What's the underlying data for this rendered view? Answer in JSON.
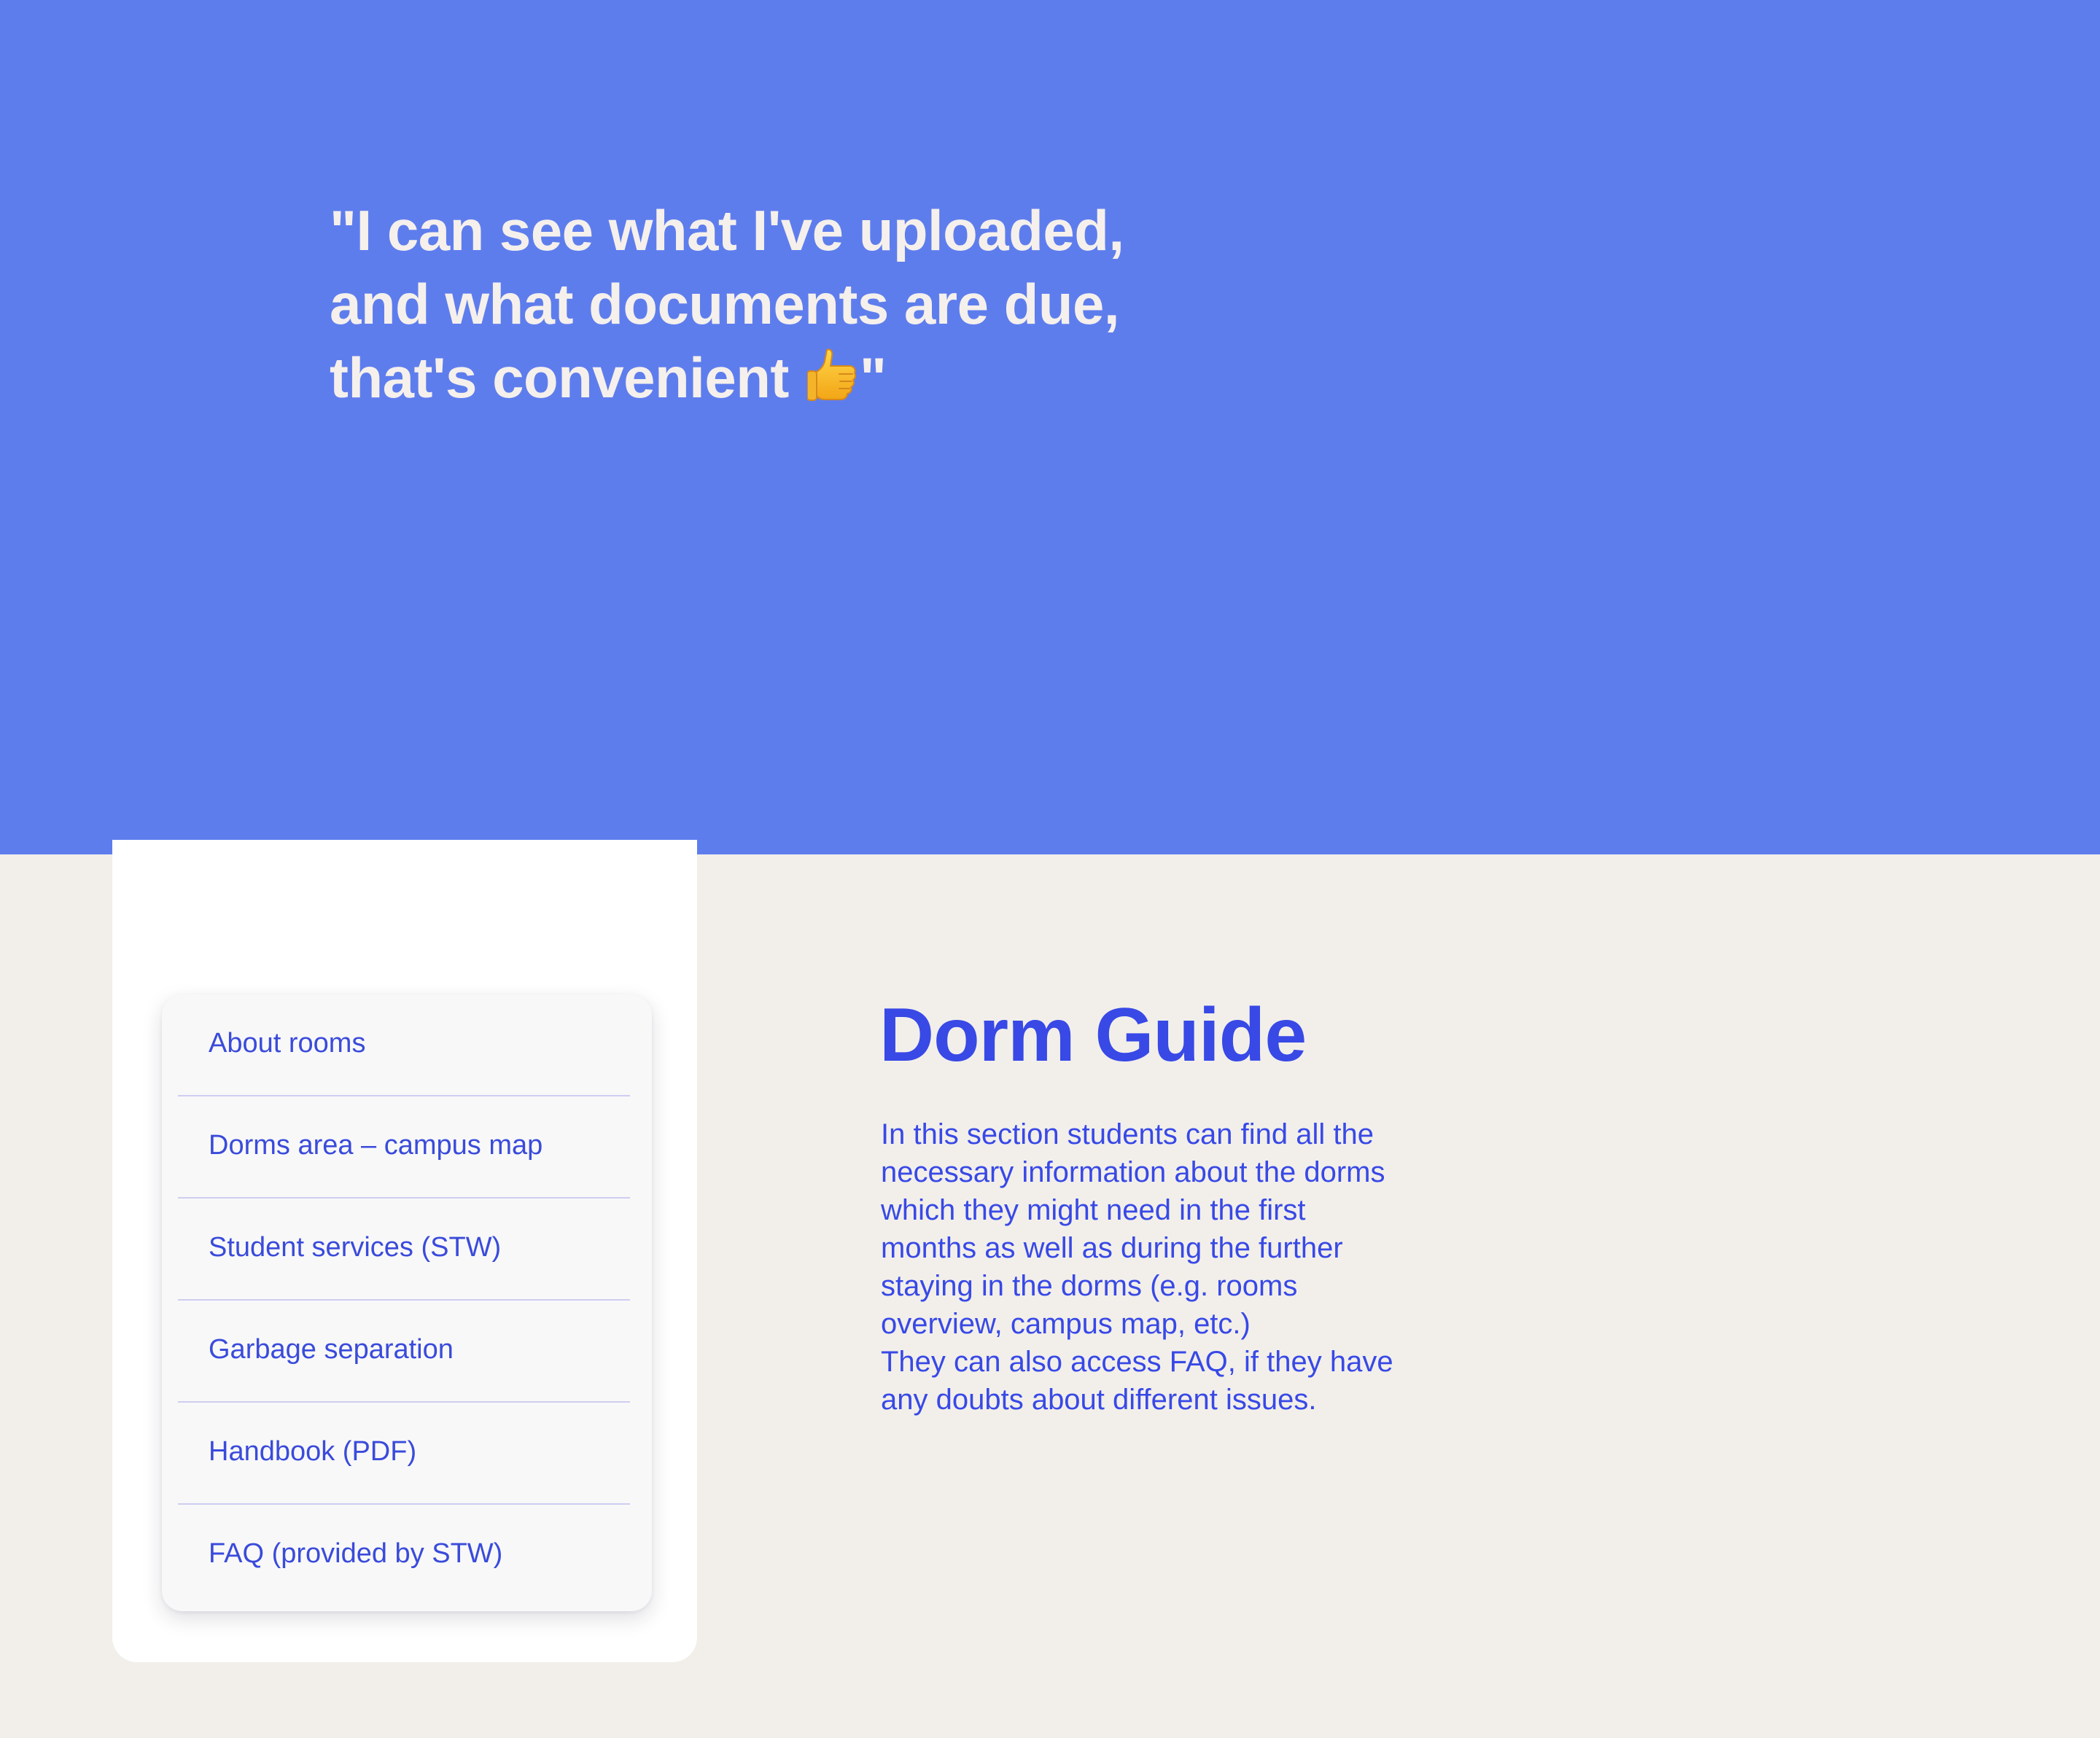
{
  "hero": {
    "quote_before_icon": "\"I can see what I've uploaded,\nand what documents are due,\nthat's convenient ",
    "quote_after_icon": "\"",
    "icon": "thumbs-up-icon",
    "background_color": "#5e7ded",
    "text_color": "#f5f0ec"
  },
  "navigation": {
    "items": [
      {
        "label": "About rooms"
      },
      {
        "label": "Dorms area – campus map"
      },
      {
        "label": "Student services (STW)"
      },
      {
        "label": "Garbage separation"
      },
      {
        "label": "Handbook (PDF)"
      },
      {
        "label": "FAQ (provided by STW)"
      }
    ],
    "link_color": "#3a4bdb",
    "divider_color": "#cfcdf1"
  },
  "content": {
    "title": "Dorm Guide",
    "body": "In this section students can find all the\nnecessary information about the dorms\nwhich they might need in the first\nmonths as well as during the further\nstaying in the dorms (e.g. rooms\noverview, campus map, etc.)\nThey can also access FAQ, if they have\nany doubts about different issues.",
    "accent_color": "#3849e6"
  },
  "page": {
    "background_color": "#f2efea"
  }
}
